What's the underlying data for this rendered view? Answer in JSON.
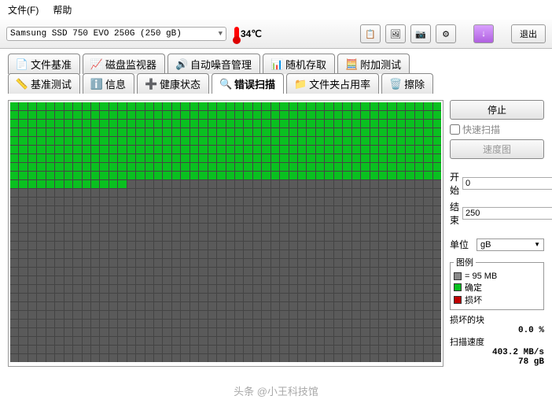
{
  "menu": {
    "file": "文件(F)",
    "help": "帮助"
  },
  "toolbar": {
    "drive": "Samsung SSD 750 EVO 250G (250 gB)",
    "temp": "34℃",
    "exit": "退出",
    "btn_down": "↓"
  },
  "tabs": {
    "row1": [
      {
        "label": "文件基准",
        "icon": "📄"
      },
      {
        "label": "磁盘监视器",
        "icon": "📈"
      },
      {
        "label": "自动噪音管理",
        "icon": "🔊"
      },
      {
        "label": "随机存取",
        "icon": "📊"
      },
      {
        "label": "附加测试",
        "icon": "🧮"
      }
    ],
    "row2": [
      {
        "label": "基准测试",
        "icon": "📏"
      },
      {
        "label": "信息",
        "icon": "ℹ️"
      },
      {
        "label": "健康状态",
        "icon": "➕"
      },
      {
        "label": "错误扫描",
        "icon": "🔍",
        "active": true
      },
      {
        "label": "文件夹占用率",
        "icon": "📁"
      },
      {
        "label": "擦除",
        "icon": "🗑️"
      }
    ]
  },
  "side": {
    "stop": "停止",
    "quick": "快速扫描",
    "speedmap": "速度图",
    "start_lbl": "开始",
    "start_val": "0",
    "end_lbl": "结束",
    "end_val": "250",
    "unit_lbl": "单位",
    "unit_val": "gB",
    "legend_title": "图例",
    "legend_block": "= 95 MB",
    "legend_ok": "确定",
    "legend_bad": "损坏",
    "damaged_title": "损坏的块",
    "damaged_val": "0.0 %",
    "speed_title": "扫描速度",
    "speed_val": "403.2 MB/s",
    "pos_val": "78 gB"
  },
  "scan": {
    "total_cells": 1440,
    "ok_cells": 445
  },
  "watermark": "头条 @小王科技馆"
}
